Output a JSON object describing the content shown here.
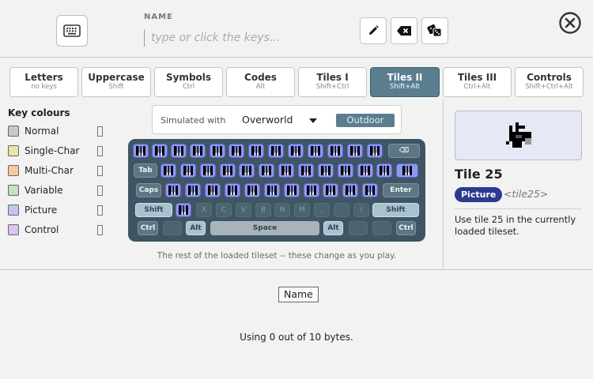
{
  "header": {
    "name_caption": "NAME",
    "name_placeholder": "type or click the keys...",
    "name_value": "",
    "buttons": {
      "keyboard": "keyboard-icon",
      "edit": "pencil-icon",
      "backspace": "backspace-icon",
      "random": "dice-icon",
      "close": "close-icon"
    }
  },
  "tabs": [
    {
      "label": "Letters",
      "sub": "no keys"
    },
    {
      "label": "Uppercase",
      "sub": "Shift"
    },
    {
      "label": "Symbols",
      "sub": "Ctrl"
    },
    {
      "label": "Codes",
      "sub": "Alt"
    },
    {
      "label": "Tiles I",
      "sub": "Shift+Ctrl"
    },
    {
      "label": "Tiles II",
      "sub": "Shift+Alt"
    },
    {
      "label": "Tiles III",
      "sub": "Ctrl+Alt"
    },
    {
      "label": "Controls",
      "sub": "Shift+Ctrl+Alt"
    }
  ],
  "active_tab": "Tiles II",
  "legend": {
    "title": "Key colours",
    "items": [
      {
        "label": "Normal",
        "color": "#c8c8c8"
      },
      {
        "label": "Single-Char",
        "color": "#e8e6a8"
      },
      {
        "label": "Multi-Char",
        "color": "#f5c9a0"
      },
      {
        "label": "Variable",
        "color": "#bfe3c4"
      },
      {
        "label": "Picture",
        "color": "#c3c6f0"
      },
      {
        "label": "Control",
        "color": "#ddc2ec"
      }
    ]
  },
  "simulation": {
    "label": "Simulated with",
    "world": "Overworld",
    "mode": "Outdoor"
  },
  "keyboard": {
    "tab": "Tab",
    "caps": "Caps",
    "enter": "Enter",
    "shift_left": "Shift",
    "shift_right": "Shift",
    "ctrl_left": "Ctrl",
    "ctrl_right": "Ctrl",
    "alt_left": "Alt",
    "alt_right": "Alt",
    "space": "Space",
    "backspace": "⌫",
    "bottom_row_letters": [
      "X",
      "C",
      "V",
      "B",
      "N",
      "M",
      ",",
      ".",
      "/"
    ],
    "caption": "The rest of the loaded tileset -- these change as you play."
  },
  "tile_info": {
    "title": "Tile 25",
    "type": "Picture",
    "code": "<tile25>",
    "description": "Use tile 25 in the currently loaded tileset."
  },
  "footer": {
    "name_chip": "Name",
    "usage": "Using 0 out of 10 bytes."
  }
}
